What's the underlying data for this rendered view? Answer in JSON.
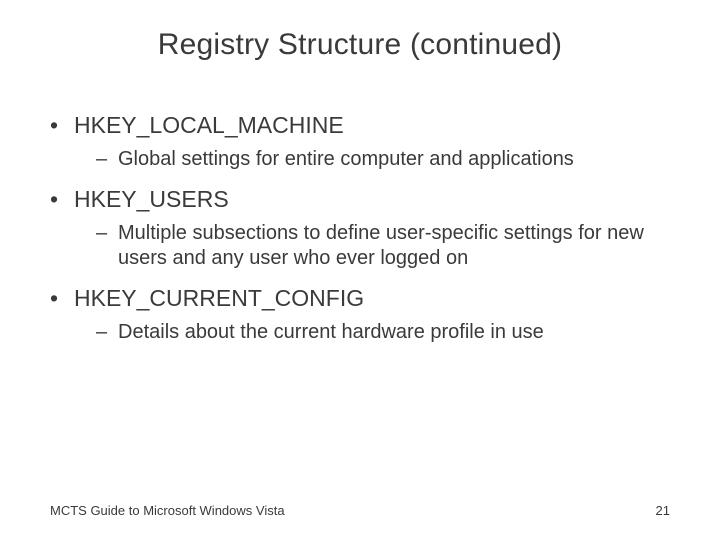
{
  "title": "Registry Structure (continued)",
  "bullets": [
    {
      "label": "HKEY_LOCAL_MACHINE",
      "sub": "Global settings for entire computer and applications"
    },
    {
      "label": "HKEY_USERS",
      "sub": "Multiple subsections to define user-specific settings for new users and any user who ever logged on"
    },
    {
      "label": "HKEY_CURRENT_CONFIG",
      "sub": "Details about the current hardware profile in use"
    }
  ],
  "footer": {
    "left": "MCTS Guide to Microsoft Windows Vista",
    "right": "21"
  }
}
